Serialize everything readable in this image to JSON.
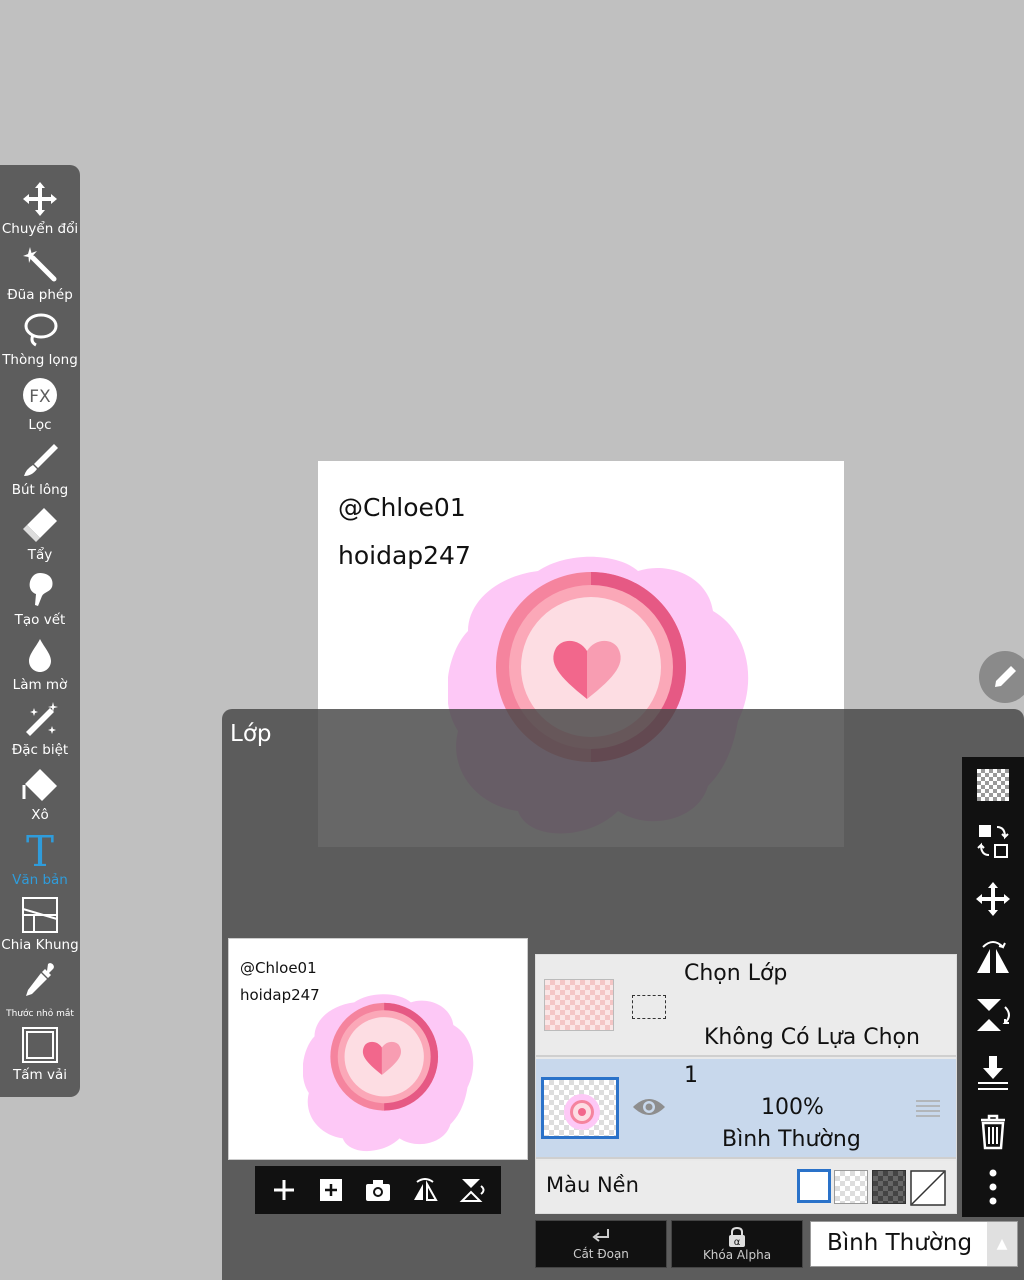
{
  "toolbar": {
    "items": [
      {
        "label": "Chuyển đổi",
        "icon": "move-arrows-icon"
      },
      {
        "label": "Đũa phép",
        "icon": "magic-wand-icon"
      },
      {
        "label": "Thòng lọng",
        "icon": "lasso-icon"
      },
      {
        "label": "Lọc",
        "icon": "fx-filter-icon"
      },
      {
        "label": "Bút lông",
        "icon": "brush-icon"
      },
      {
        "label": "Tẩy",
        "icon": "eraser-icon"
      },
      {
        "label": "Tạo vết",
        "icon": "smudge-icon"
      },
      {
        "label": "Làm mờ",
        "icon": "blur-drop-icon"
      },
      {
        "label": "Đặc biệt",
        "icon": "special-wand-icon"
      },
      {
        "label": "Xô",
        "icon": "bucket-icon"
      },
      {
        "label": "Văn bản",
        "icon": "text-icon",
        "active": true
      },
      {
        "label": "Chia Khung",
        "icon": "frame-divider-icon"
      },
      {
        "label": "Thước nhỏ mắt",
        "icon": "eyedropper-icon"
      },
      {
        "label": "Tấm vải",
        "icon": "canvas-icon"
      }
    ]
  },
  "canvas": {
    "line1": "@Chloe01",
    "line2": "hoidap247"
  },
  "layer_panel": {
    "title": "Lớp",
    "selection_row": {
      "title": "Chọn Lớp",
      "status": "Không Có Lựa Chọn"
    },
    "layer_row": {
      "name": "1",
      "opacity": "100%",
      "blend": "Bình Thường"
    },
    "background_row": {
      "label": "Màu Nền"
    },
    "clip_button": "Cắt Đoạn",
    "alpha_lock_button": "Khóa Alpha",
    "blend_mode": "Bình Thường"
  },
  "colors": {
    "accent": "#2f9cdb",
    "layer_selected": "#c8d8ec",
    "pink_blob": "#fdc8f6",
    "ring": "#f27a96",
    "heart": "#f0628a"
  }
}
